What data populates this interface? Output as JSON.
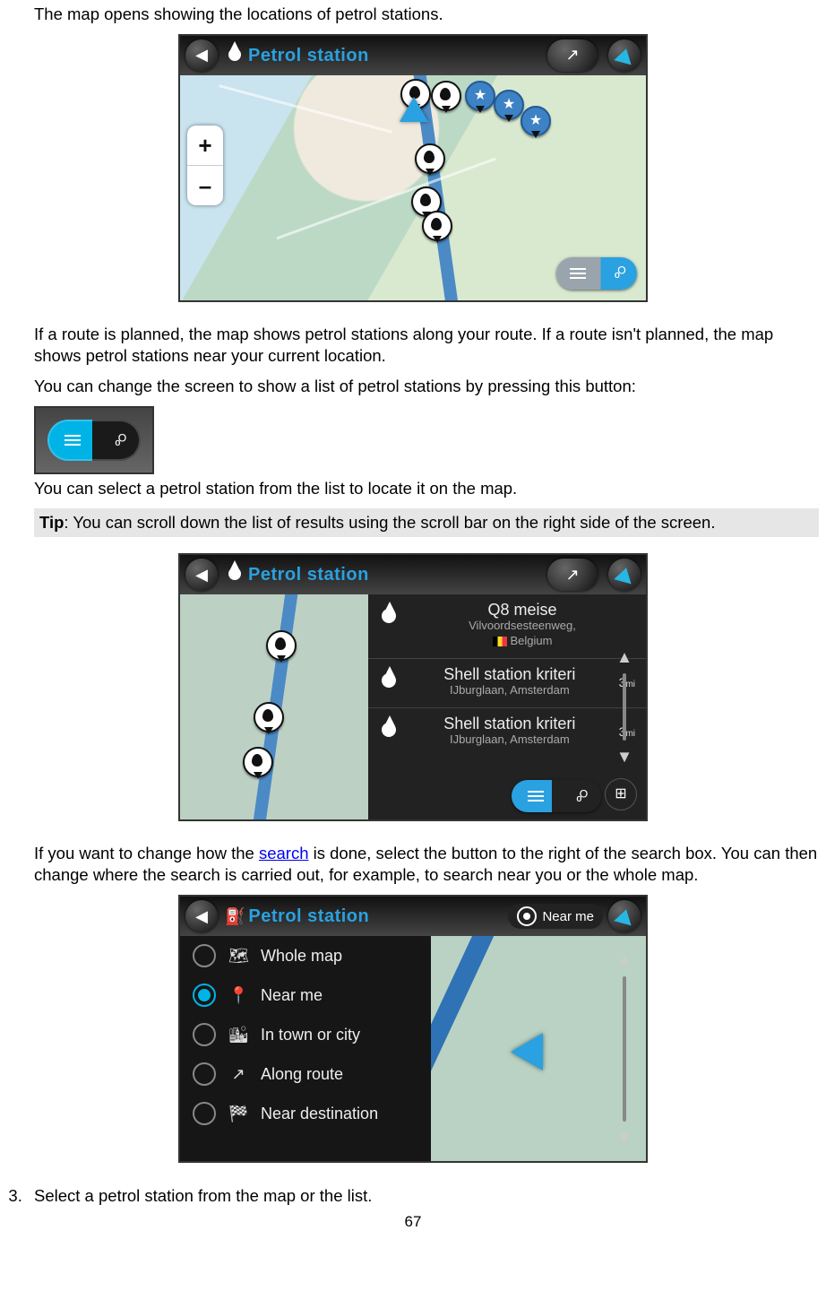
{
  "para1": "The map opens showing the locations of petrol stations.",
  "shot1": {
    "search_label": "Petrol station",
    "zoom_plus": "+",
    "zoom_minus": "–"
  },
  "para2": "If a route is planned, the map shows petrol stations along your route. If a route isn't planned, the map shows petrol stations near your current location.",
  "para3": "You can change the screen to show a list of petrol stations by pressing this button:",
  "para4": "You can select a petrol station from the list to locate it on the map.",
  "tip_label": "Tip",
  "tip_text": ": You can scroll down the list of results using the scroll bar on the right side of the screen.",
  "shot2": {
    "search_label": "Petrol station",
    "list": [
      {
        "name": "Q8 meise",
        "sub": "Vilvoordsesteenweg,",
        "country": "Belgium",
        "dist": "",
        "flag": true
      },
      {
        "name": "Shell station kriteri",
        "sub": "IJburglaan, Amsterdam",
        "dist": "3",
        "dist_unit": "mi"
      },
      {
        "name": "Shell station kriteri",
        "sub": "IJburglaan, Amsterdam",
        "dist": "3",
        "dist_unit": "mi"
      }
    ]
  },
  "para5_pre": "If you want to change how the ",
  "para5_link": "search",
  "para5_post": " is done, select the button to the right of the search box. You can then change where the search is carried out, for example, to search near you or the whole map.",
  "shot3": {
    "search_label": "Petrol station",
    "near_me": "Near me",
    "options": [
      {
        "label": "Whole map",
        "icon": "🗺",
        "selected": false
      },
      {
        "label": "Near me",
        "icon": "📍",
        "selected": true
      },
      {
        "label": "In town or city",
        "icon": "🏙",
        "selected": false
      },
      {
        "label": "Along route",
        "icon": "↗",
        "selected": false
      },
      {
        "label": "Near destination",
        "icon": "🏁",
        "selected": false
      }
    ]
  },
  "step3_num_start": 3,
  "step3": "Select a petrol station from the map or the list.",
  "page_number": "67"
}
